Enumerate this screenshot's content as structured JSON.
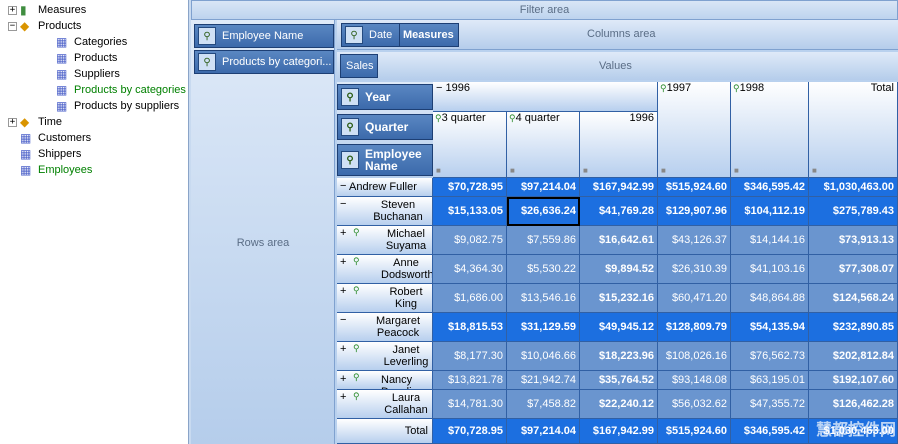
{
  "tree": [
    {
      "label": "Measures",
      "icon": "bar-chart-icon",
      "exp": "+",
      "indent": 0,
      "green": false
    },
    {
      "label": "Products",
      "icon": "cube-icon",
      "exp": "−",
      "indent": 0,
      "green": false
    },
    {
      "label": "Categories",
      "icon": "level-icon",
      "exp": "",
      "indent": 1,
      "green": false
    },
    {
      "label": "Products",
      "icon": "level-icon",
      "exp": "",
      "indent": 1,
      "green": false
    },
    {
      "label": "Suppliers",
      "icon": "level-icon",
      "exp": "",
      "indent": 1,
      "green": false
    },
    {
      "label": "Products by categories",
      "icon": "hierarchy-icon",
      "exp": "",
      "indent": 1,
      "green": true
    },
    {
      "label": "Products by suppliers",
      "icon": "level-icon",
      "exp": "",
      "indent": 1,
      "green": false
    },
    {
      "label": "Time",
      "icon": "cube-icon",
      "exp": "+",
      "indent": 0,
      "green": false
    },
    {
      "label": "Customers",
      "icon": "level-icon",
      "exp": "",
      "indent": 0,
      "green": false
    },
    {
      "label": "Shippers",
      "icon": "level-icon",
      "exp": "",
      "indent": 0,
      "green": false
    },
    {
      "label": "Employees",
      "icon": "hierarchy-icon",
      "exp": "",
      "indent": 0,
      "green": true
    }
  ],
  "filter_area": "Filter area",
  "rows_area": "Rows area",
  "columns_area": "Columns area",
  "values_area": "Values",
  "row_fields": [
    "Employee Name",
    "Products  by  categori..."
  ],
  "col_fields": {
    "date": "Date",
    "measures": "Measures"
  },
  "data_field": "Sales",
  "levels": [
    "Year",
    "Quarter",
    "Employee Name"
  ],
  "col_headers": {
    "y1996": "1996",
    "q3": "3 quarter",
    "q4": "4 quarter",
    "t1996": "1996",
    "y1997": "1997",
    "y1998": "1998",
    "total": "Total"
  },
  "rows": [
    {
      "name": "Andrew Fuller",
      "mark": "−",
      "sub": false,
      "v": [
        "$70,728.95",
        "$97,214.04",
        "$167,942.99",
        "$515,924.60",
        "$346,595.42",
        "$1,030,463.00"
      ],
      "style": "bright"
    },
    {
      "name": "Steven Buchanan",
      "mark": "−",
      "sub": false,
      "v": [
        "$15,133.05",
        "$26,636.24",
        "$41,769.28",
        "$129,907.96",
        "$104,112.19",
        "$275,789.43"
      ],
      "style": "bright"
    },
    {
      "name": "Michael Suyama",
      "mark": "+",
      "sub": true,
      "v": [
        "$9,082.75",
        "$7,559.86",
        "$16,642.61",
        "$43,126.37",
        "$14,144.16",
        "$73,913.13"
      ],
      "style": "dim"
    },
    {
      "name": "Anne Dodsworth",
      "mark": "+",
      "sub": true,
      "v": [
        "$4,364.30",
        "$5,530.22",
        "$9,894.52",
        "$26,310.39",
        "$41,103.16",
        "$77,308.07"
      ],
      "style": "dim"
    },
    {
      "name": "Robert King",
      "mark": "+",
      "sub": true,
      "v": [
        "$1,686.00",
        "$13,546.16",
        "$15,232.16",
        "$60,471.20",
        "$48,864.88",
        "$124,568.24"
      ],
      "style": "dim"
    },
    {
      "name": "Margaret Peacock",
      "mark": "−",
      "sub": false,
      "v": [
        "$18,815.53",
        "$31,129.59",
        "$49,945.12",
        "$128,809.79",
        "$54,135.94",
        "$232,890.85"
      ],
      "style": "bright"
    },
    {
      "name": "Janet Leverling",
      "mark": "+",
      "sub": true,
      "v": [
        "$8,177.30",
        "$10,046.66",
        "$18,223.96",
        "$108,026.16",
        "$76,562.73",
        "$202,812.84"
      ],
      "style": "dim"
    },
    {
      "name": "Nancy Davolio",
      "mark": "+",
      "sub": true,
      "v": [
        "$13,821.78",
        "$21,942.74",
        "$35,764.52",
        "$93,148.08",
        "$63,195.01",
        "$192,107.60"
      ],
      "style": "dim"
    },
    {
      "name": "Laura Callahan",
      "mark": "+",
      "sub": true,
      "v": [
        "$14,781.30",
        "$7,458.82",
        "$22,240.12",
        "$56,032.62",
        "$47,355.72",
        "$126,462.28"
      ],
      "style": "dim"
    }
  ],
  "total_row": {
    "label": "Total",
    "v": [
      "$70,728.95",
      "$97,214.04",
      "$167,942.99",
      "$515,924.60",
      "$346,595.42",
      "$1,030,463.00"
    ]
  },
  "watermark": "慧都控件网"
}
